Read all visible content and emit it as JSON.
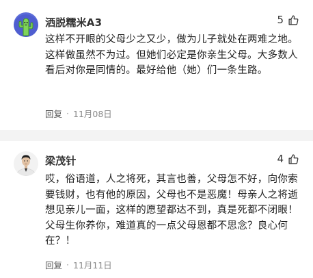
{
  "comments": [
    {
      "username": "洒脱糯米A3",
      "likes": "5",
      "text": "这样不开眼的父母少之又少，做为儿子就处在两难之地。这样做虽然不为过。但她们必定是你亲生父母。大多数人看后对你是同情的。最好给他（她）们一条生路。",
      "reply_label": "回复",
      "separator": "·",
      "timestamp": "11月08日",
      "avatar_icon": "cactus-avatar-icon",
      "avatar_bg": "#5b6bd8"
    },
    {
      "username": "梁茂针",
      "likes": "4",
      "text": "哎，俗语道，人之将死，其言也善，父母怎不好，向你索要钱财，也有他的原因，父母也不是恶魔！母亲人之将逝想见亲儿一面，这样的愿望都达不到，真是死都不闭眼！父母生你养你，难道真的一点父母恩都不思念？良心何在？！",
      "reply_label": "回复",
      "separator": "·",
      "timestamp": "11月11日",
      "avatar_icon": "person-photo-avatar-icon",
      "avatar_bg": "#f2f2f2"
    }
  ],
  "like_icon": "thumbs-up-icon"
}
